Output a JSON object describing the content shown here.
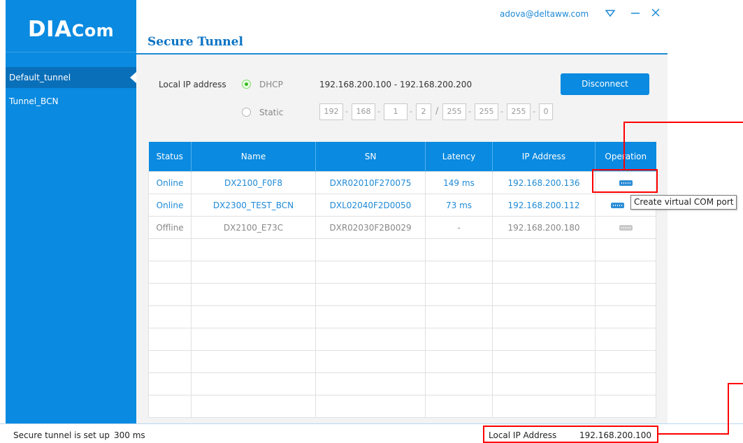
{
  "app": {
    "logo": "DIA",
    "logo_suffix": "Com"
  },
  "header": {
    "user_email": "adova@deltaww.com",
    "title": "Secure Tunnel"
  },
  "sidebar": {
    "items": [
      {
        "label": "Default_tunnel",
        "active": true
      },
      {
        "label": "Tunnel_BCN",
        "active": false
      }
    ]
  },
  "settings": {
    "local_ip_label": "Local IP address",
    "dhcp_label": "DHCP",
    "static_label": "Static",
    "mode": "DHCP",
    "dhcp_range": "192.168.200.100 - 192.168.200.200",
    "static_ip": [
      "192",
      "168",
      "1",
      "2"
    ],
    "static_mask": [
      "255",
      "255",
      "255",
      "0"
    ],
    "disconnect_label": "Disconnect"
  },
  "table": {
    "headers": [
      "Status",
      "Name",
      "SN",
      "Latency",
      "IP Address",
      "Operation"
    ],
    "rows": [
      {
        "status": "Online",
        "name": "DX2100_F0F8",
        "sn": "DXR02010F270075",
        "latency": "149 ms",
        "ip": "192.168.200.136",
        "op_icon": "com-port-icon",
        "enabled": true
      },
      {
        "status": "Online",
        "name": "DX2300_TEST_BCN",
        "sn": "DXL02040F2D0050",
        "latency": "73 ms",
        "ip": "192.168.200.112",
        "op_icon": "com-port-icon",
        "enabled": true
      },
      {
        "status": "Offline",
        "name": "DX2100_E73C",
        "sn": "DXR02030F2B0029",
        "latency": "-",
        "ip": "192.168.200.180",
        "op_icon": "com-port-icon",
        "enabled": false
      }
    ],
    "empty_rows": 8
  },
  "tooltip": "Create virtual COM port",
  "status_bar": {
    "message": "Secure tunnel is set up",
    "latency": "300 ms",
    "local_ip_label": "Local IP Address",
    "local_ip_value": "192.168.200.100"
  },
  "colors": {
    "accent": "#0a8ae0",
    "online": "#1e8ad6",
    "offline": "#888888",
    "annotation": "#ff0000"
  }
}
